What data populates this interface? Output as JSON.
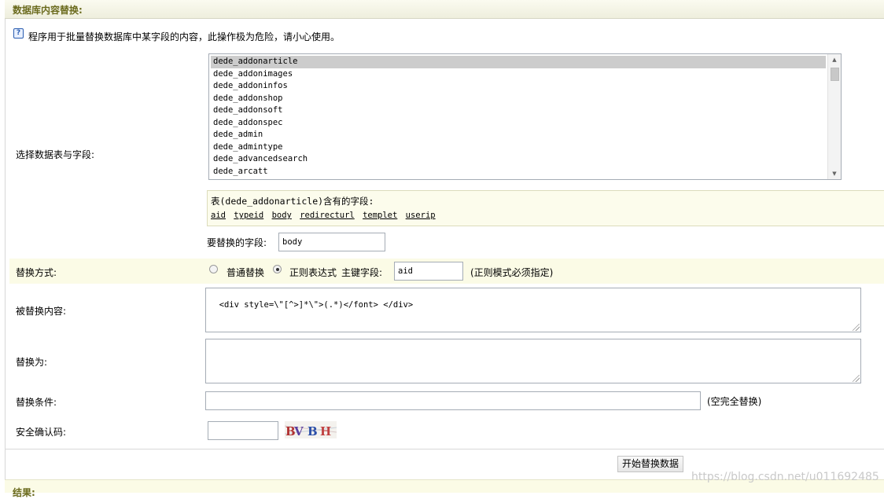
{
  "header": {
    "title": "数据库内容替换:"
  },
  "hint": {
    "icon": "help-icon",
    "text": "程序用于批量替换数据库中某字段的内容，此操作极为危险，请小心使用。"
  },
  "labels": {
    "select_table": "选择数据表与字段:",
    "replace_mode": "替换方式:",
    "replaced_content": "被替换内容:",
    "replace_with": "替换为:",
    "condition": "替换条件:",
    "captcha": "安全确认码:"
  },
  "tables": {
    "selected": "dede_addonarticle",
    "items": [
      "dede_addonarticle",
      "dede_addonimages",
      "dede_addoninfos",
      "dede_addonshop",
      "dede_addonsoft",
      "dede_addonspec",
      "dede_admin",
      "dede_admintype",
      "dede_advancedsearch",
      "dede_arcatt"
    ]
  },
  "fields_panel": {
    "title": "表(dede_addonarticle)含有的字段:",
    "fields": [
      "aid",
      "typeid",
      "body",
      "redirecturl",
      "templet",
      "userip"
    ]
  },
  "field_to_replace": {
    "label": "要替换的字段:",
    "value": "body"
  },
  "mode": {
    "option_normal": "普通替换",
    "option_regex": "正则表达式",
    "selected": "正则表达式",
    "key_field_label": "主键字段:",
    "key_field_value": "aid",
    "note": "(正则模式必须指定)"
  },
  "replaced_content": {
    "value": "<div style=\\\"[^>]*\\\">(.*)</font> </div>"
  },
  "replace_with": {
    "value": ""
  },
  "condition": {
    "value": "",
    "note": "(空完全替换)"
  },
  "captcha": {
    "value": "",
    "image_text": "BVBH"
  },
  "submit": {
    "label": "开始替换数据"
  },
  "footer": {
    "title": "结果:"
  },
  "watermark": "https://blog.csdn.net/u011692485",
  "colors": {
    "header_text": "#6b6b1e",
    "highlight_row": "#fbfbe6",
    "selected_item": "#cccccc"
  }
}
